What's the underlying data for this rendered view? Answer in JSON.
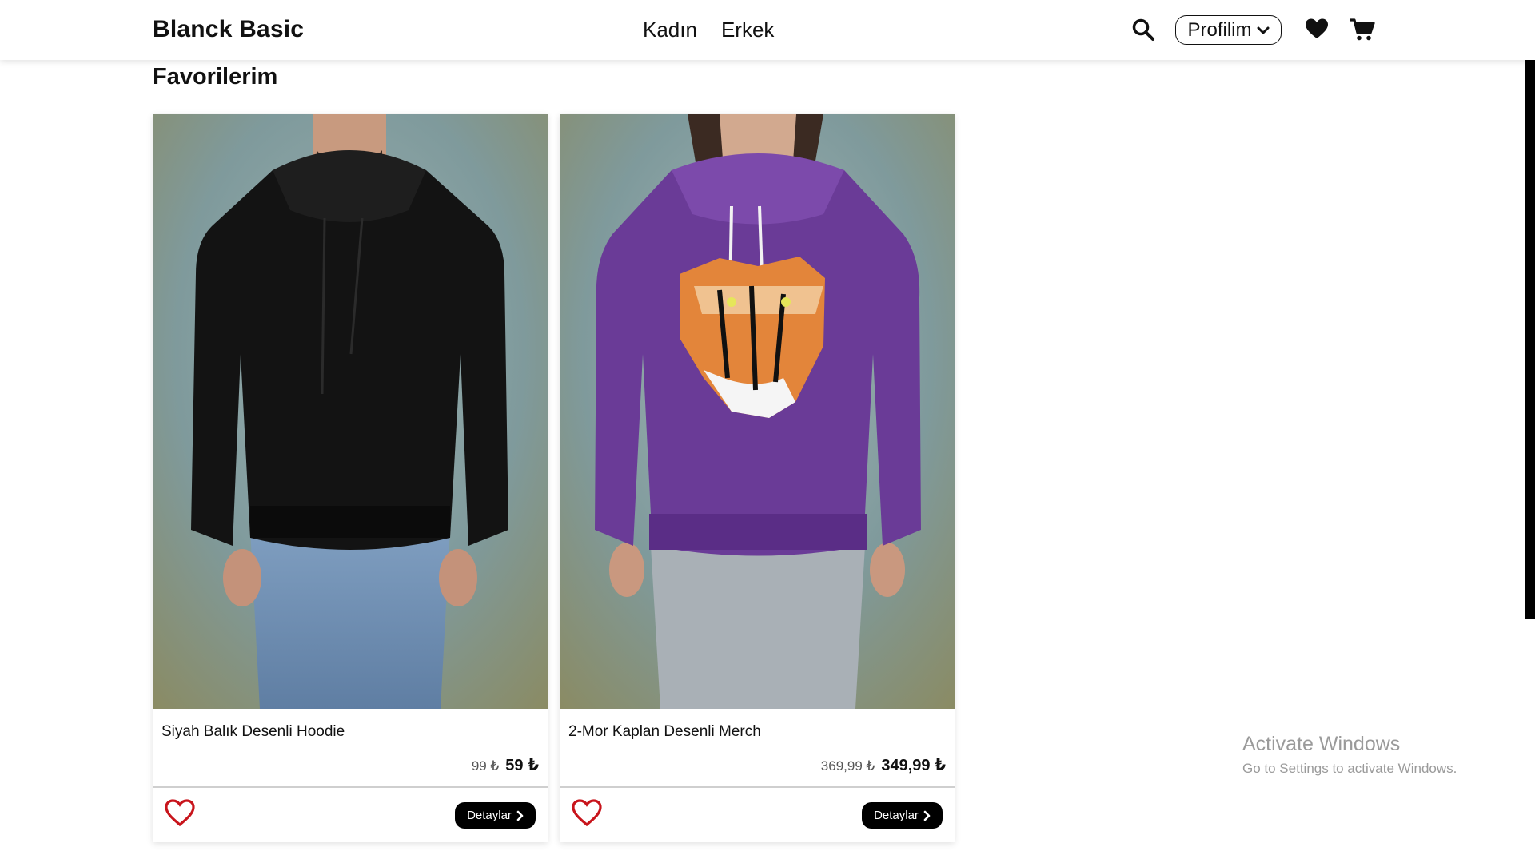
{
  "header": {
    "brand": "Blanck Basic",
    "nav": [
      "Kadın",
      "Erkek"
    ],
    "profile_label": "Profilim",
    "icons": [
      "search-icon",
      "chevron-down-icon",
      "heart-icon",
      "cart-icon"
    ]
  },
  "page": {
    "title": "Favorilerim"
  },
  "products": [
    {
      "name": "Siyah Balık Desenli Hoodie",
      "old_price": "99 ₺",
      "price": "59 ₺",
      "details_label": "Detaylar",
      "hoodie_color": "#131313"
    },
    {
      "name": "2-Mor Kaplan Desenli Merch",
      "old_price": "369,99 ₺",
      "price": "349,99 ₺",
      "details_label": "Detaylar",
      "hoodie_color": "#6a3b97"
    }
  ],
  "colors": {
    "accent_heart": "#c8141b",
    "button": "#000000"
  },
  "overlay": {
    "title": "Activate Windows",
    "subtitle": "Go to Settings to activate Windows."
  }
}
